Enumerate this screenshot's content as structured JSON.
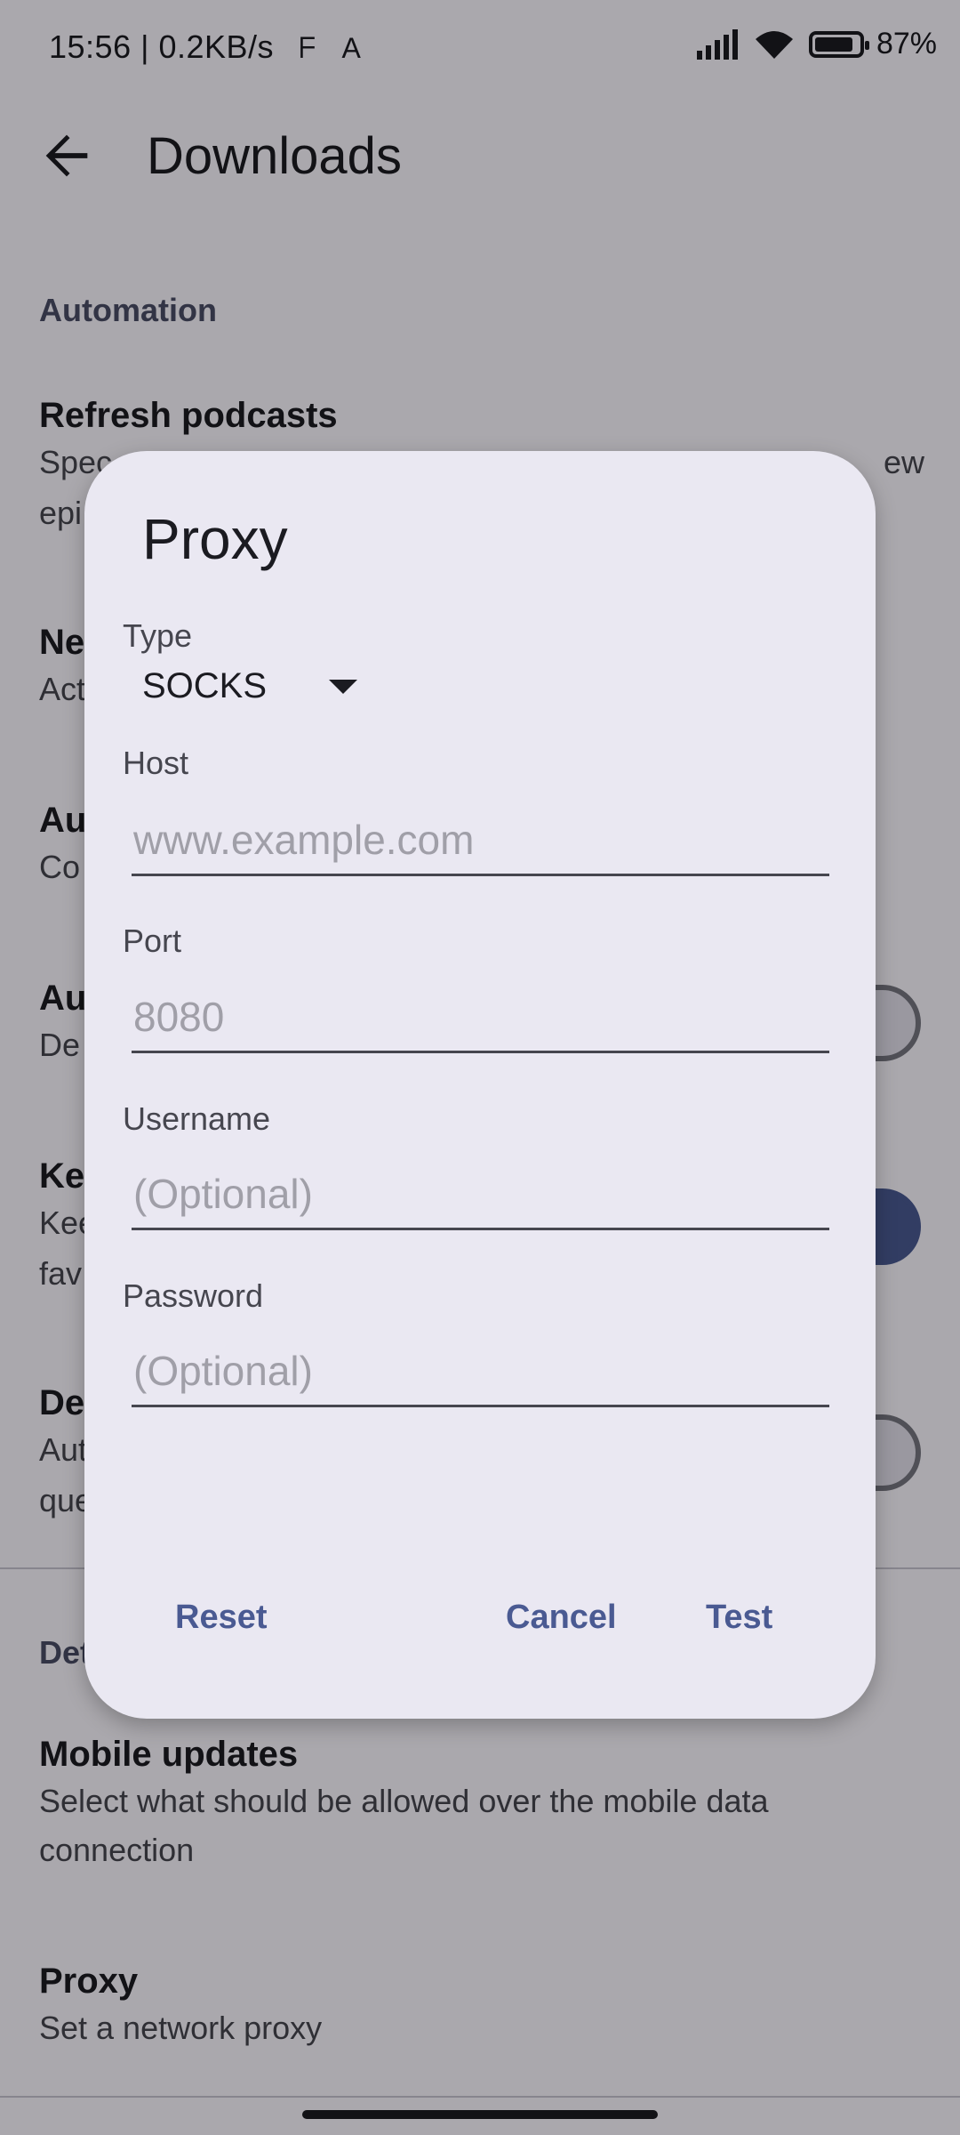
{
  "status_bar": {
    "time_speed": "15:56 | 0.2KB/s",
    "battery": "87%",
    "battery_level": 0.87
  },
  "app_bar": {
    "title": "Downloads",
    "back_icon": "arrow-back-icon"
  },
  "background": {
    "section_automation": "Automation",
    "refresh_title": "Refresh podcasts",
    "refresh_sum_left": "Spec",
    "refresh_sum_right": "ew",
    "refresh_sum_line2": "epi",
    "item2_title": "Ne",
    "item2_sum": "Act",
    "item3_title": "Au",
    "item3_sum": "Co",
    "item4_title": "Au",
    "item4_sum": "De",
    "item5_title": "Ke",
    "item5_sum": "Kee",
    "item5_sum2": "fav",
    "item6_title": "De",
    "item6_sum": "Aut",
    "item6_sum2": "que",
    "section_details": "Det",
    "mobile_title": "Mobile updates",
    "mobile_sum": "Select what should be allowed over the mobile data connection",
    "proxy_title": "Proxy",
    "proxy_sum": "Set a network proxy"
  },
  "dialog": {
    "title": "Proxy",
    "type_label": "Type",
    "type_value": "SOCKS",
    "host_label": "Host",
    "host_placeholder": "www.example.com",
    "port_label": "Port",
    "port_placeholder": "8080",
    "username_label": "Username",
    "username_placeholder": "(Optional)",
    "password_label": "Password",
    "password_placeholder": "(Optional)",
    "reset_label": "Reset",
    "cancel_label": "Cancel",
    "test_label": "Test"
  }
}
